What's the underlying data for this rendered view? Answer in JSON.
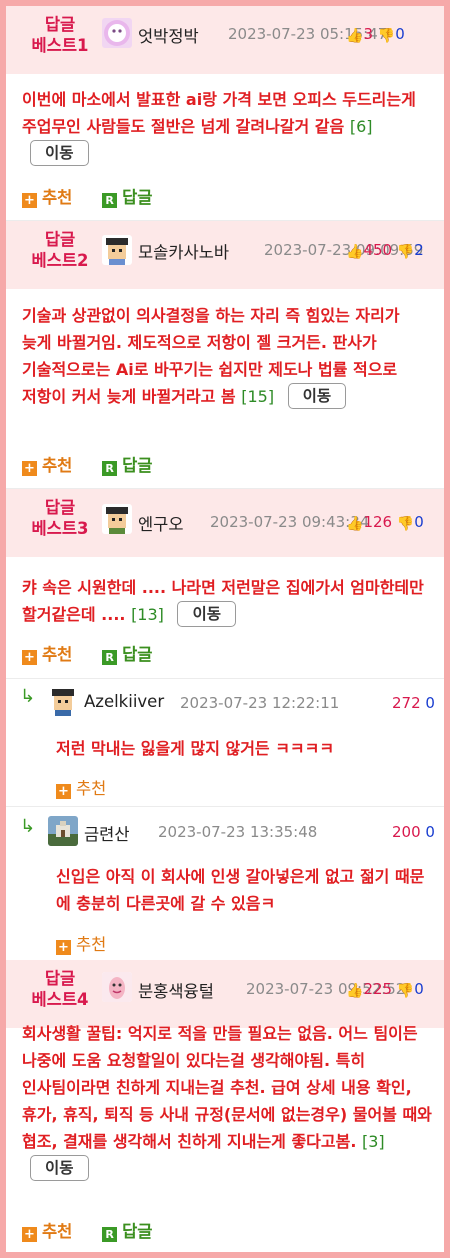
{
  "posts": [
    {
      "tag_line1": "답글",
      "tag_line2": "베스트1",
      "nick": "엇박정박",
      "date": "2023-07-23 05:15:47",
      "up": "3",
      "down": "0",
      "text": "이번에 마소에서 발표한 ai랑 가격 보면 오피스 두드리는게 주업무인 사람들도 절반은 넘게 갈려나갈거 같음",
      "reply_count": "[6]",
      "move_label": "이동",
      "recommend_label": "추천",
      "reply_label": "답글"
    },
    {
      "tag_line1": "답글",
      "tag_line2": "베스트2",
      "nick": "모솔카사노바",
      "date": "2023-07-23 09:09:59",
      "up": "450",
      "down": "2",
      "text": "기술과 상관없이 의사결정을 하는 자리 즉 힘있는 자리가 늦게 바뀔거임. 제도적으로 저항이 젤 크거든. 판사가 기술적으로는 Ai로 바꾸기는 쉽지만 제도나 법률 적으로 저항이 커서 늦게 바뀔거라고 봄",
      "reply_count": "[15]",
      "move_label": "이동",
      "recommend_label": "추천",
      "reply_label": "답글"
    },
    {
      "tag_line1": "답글",
      "tag_line2": "베스트3",
      "nick": "엔구오",
      "date": "2023-07-23 09:43:34",
      "up": "126",
      "down": "0",
      "text": "캬 속은 시원한데 .... 나라면 저런말은 집에가서 엄마한테만 할거같은데 ....",
      "reply_count": "[13]",
      "move_label": "이동",
      "recommend_label": "추천",
      "reply_label": "답글"
    },
    {
      "tag_line1": "답글",
      "tag_line2": "베스트4",
      "nick": "분홍색융털",
      "date": "2023-07-23 09:52:52",
      "up": "225",
      "down": "0",
      "text": "회사생활 꿀팁: 억지로 적을 만들 필요는 없음. 어느 팀이든 나중에 도움 요청할일이 있다는걸 생각해야됨. 특히 인사팀이라면 친하게 지내는걸 추천. 급여 상세 내용 확인, 휴가, 휴직, 퇴직 등 사내 규정(문서에 없는경우) 물어볼 때와 협조, 결재를 생각해서 친하게 지내는게 좋다고봄.",
      "reply_count": "[3]",
      "move_label": "이동",
      "recommend_label": "추천",
      "reply_label": "답글"
    }
  ],
  "replies": [
    {
      "arrow": "↳",
      "nick": "Azelkiiver",
      "date": "2023-07-23 12:22:11",
      "up": "272",
      "down": "0",
      "text": "저런 막내는 잃을게 많지 않거든 ㅋㅋㅋㅋ",
      "recommend_label": "추천"
    },
    {
      "arrow": "↳",
      "nick": "금련산",
      "date": "2023-07-23 13:35:48",
      "up": "200",
      "down": "0",
      "text": "신입은 아직 이 회사에 인생 갈아넣은게 없고 젊기 때문에 충분히 다른곳에 갈 수 있음ㅋ",
      "recommend_label": "추천"
    }
  ],
  "colors": {
    "frame": "#f6a9a9",
    "head_bg": "#fde8e8",
    "best_tag": "#d8194d",
    "content_red": "#e01e22",
    "count_green": "#2e8b26",
    "up_red": "#d8194d",
    "down_blue": "#1a3ed0"
  },
  "icons": {
    "thumb_up": "thumbs-up-icon",
    "thumb_down": "thumbs-down-icon",
    "plus": "plus-icon",
    "reply_r": "reply-r-icon",
    "reply_arrow": "reply-arrow-icon"
  }
}
